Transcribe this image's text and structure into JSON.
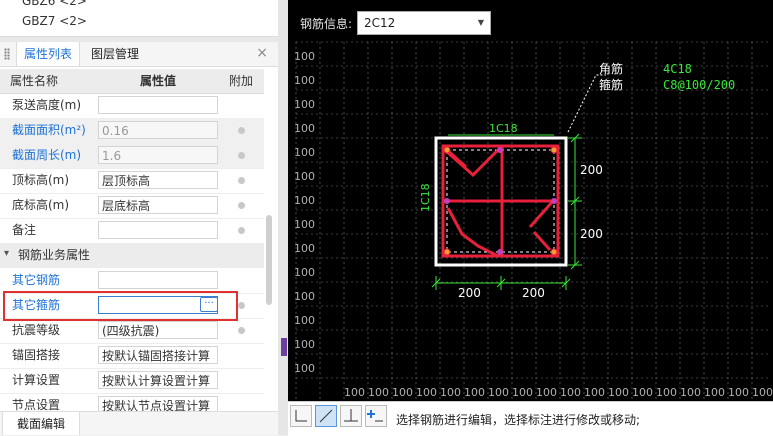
{
  "tree": {
    "item1": "GBZ6 <2>",
    "item2": "GBZ7 <2>"
  },
  "tabs": {
    "properties": "属性列表",
    "layers": "图层管理",
    "close": "×"
  },
  "table_header": {
    "name": "属性名称",
    "value": "属性值",
    "extra": "附加"
  },
  "rows": [
    {
      "label": "泵送高度(m)",
      "value": ""
    },
    {
      "label": "截面面积(m²)",
      "value": "0.16"
    },
    {
      "label": "截面周长(m)",
      "value": "1.6"
    },
    {
      "label": "顶标高(m)",
      "value": "层顶标高"
    },
    {
      "label": "底标高(m)",
      "value": "层底标高"
    },
    {
      "label": "备注",
      "value": ""
    }
  ],
  "group": {
    "label": "钢筋业务属性",
    "toggle": "▾"
  },
  "rows2": [
    {
      "label": "其它钢筋",
      "value": ""
    },
    {
      "label": "其它箍筋",
      "value": "",
      "button": "···"
    },
    {
      "label": "抗震等级",
      "value": "(四级抗震)"
    },
    {
      "label": "锚固搭接",
      "value": "按默认锚固搭接计算"
    },
    {
      "label": "计算设置",
      "value": "按默认计算设置计算"
    },
    {
      "label": "节点设置",
      "value": "按默认节点设置计算"
    }
  ],
  "bottom_tab": "截面编辑",
  "canvas": {
    "info_label": "钢筋信息:",
    "info_value": "2C12",
    "grid_label": "100",
    "corner_label": "角筋",
    "corner_value": "4C18",
    "stirrup_label": "箍筋",
    "stirrup_value": "C8@100/200",
    "top_rebar": "1C18",
    "side_rebar": "1C18",
    "dim_right_top": "200",
    "dim_right_bottom": "200",
    "dim_bottom_left": "200",
    "dim_bottom_right": "200"
  },
  "toolbar": {
    "status": "选择钢筋进行编辑，选择标注进行修改或移动;",
    "tool_icons": [
      "corner-line-icon",
      "diagonal-line-icon",
      "baseline-icon",
      "add-point-icon"
    ]
  },
  "colors": {
    "rebar": "#e8213a",
    "dimension": "#39e639",
    "grid": "#7a7a7a",
    "accent": "#1e73d6",
    "highlight": "#e03030"
  }
}
